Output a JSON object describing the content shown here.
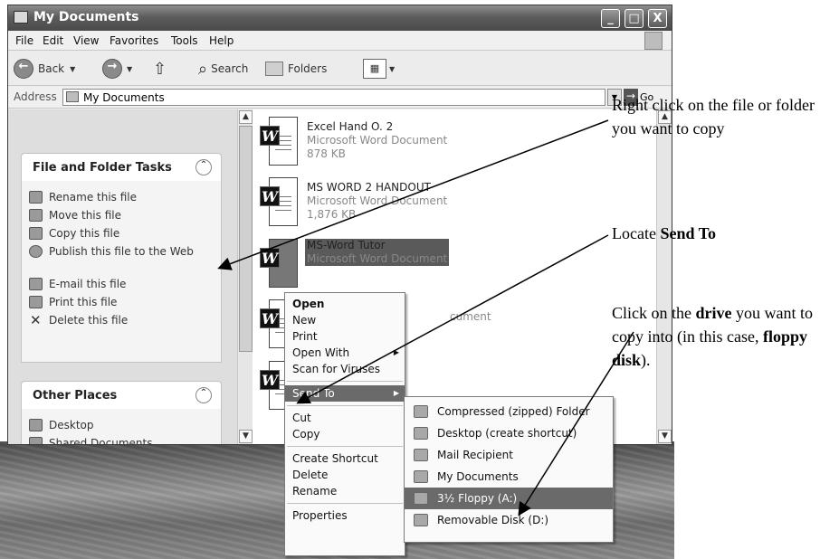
{
  "window": {
    "title": "My Documents",
    "buttons": [
      "_",
      "□",
      "X"
    ]
  },
  "menubar": [
    "File",
    "Edit",
    "View",
    "Favorites",
    "Tools",
    "Help"
  ],
  "toolbar": {
    "back": "Back",
    "search": "Search",
    "folders": "Folders"
  },
  "address": {
    "label": "Address",
    "value": "My Documents",
    "go": "Go"
  },
  "left_pane": {
    "tasks_title": "File and Folder Tasks",
    "tasks": [
      "Rename this file",
      "Move this file",
      "Copy this file",
      "Publish this file to the Web",
      "E-mail this file",
      "Print this file",
      "Delete this file"
    ],
    "places_title": "Other Places",
    "places": [
      "Desktop",
      "Shared Documents"
    ]
  },
  "files": [
    {
      "name": "Excel Hand O. 2",
      "type": "Microsoft Word Document",
      "size": "878 KB"
    },
    {
      "name": "MS WORD 2 HANDOUT",
      "type": "Microsoft Word Document",
      "size": "1,876 KB"
    },
    {
      "name": "MS-Word Tutor",
      "type": "Microsoft Word Document",
      "size": ""
    },
    {
      "name": "",
      "type": "cument",
      "size": ""
    }
  ],
  "context_menu": [
    "Open",
    "New",
    "Print",
    "Open With",
    "Scan for Viruses",
    "Send To",
    "Cut",
    "Copy",
    "Create Shortcut",
    "Delete",
    "Rename",
    "Properties"
  ],
  "send_to": [
    "Compressed (zipped) Folder",
    "Desktop (create shortcut)",
    "Mail Recipient",
    "My Documents",
    "3½ Floppy (A:)",
    "Removable Disk (D:)"
  ],
  "annotations": {
    "a1": "Right click on the file or folder you want to copy",
    "a2_pre": "Locate ",
    "a2_bold": "Send To",
    "a3_1": "Click on the ",
    "a3_b1": "drive",
    "a3_2": " you want to copy into (in this case, ",
    "a3_b2": "floppy disk",
    "a3_3": ")."
  },
  "colors": {
    "titlebar": "#5d5d5d",
    "highlight": "#6a6a6a",
    "pane": "#dedede"
  }
}
